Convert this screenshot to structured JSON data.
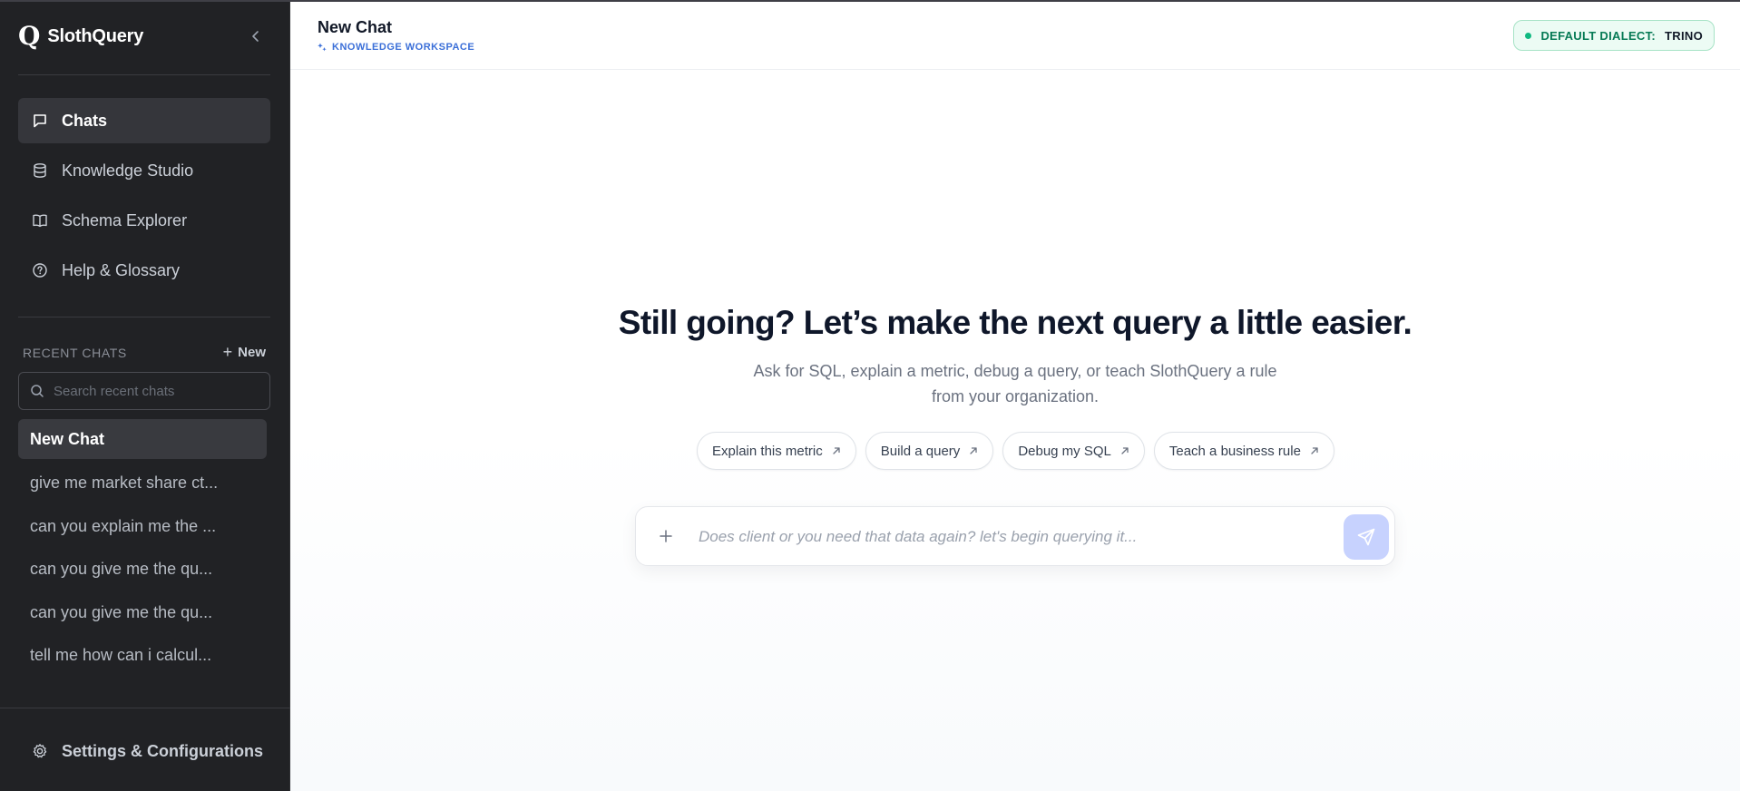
{
  "app": {
    "logo_glyph": "Q",
    "name": "SlothQuery"
  },
  "sidebar": {
    "nav": [
      {
        "label": "Chats",
        "icon": "chat-bubble-icon",
        "active": true
      },
      {
        "label": "Knowledge Studio",
        "icon": "database-icon",
        "active": false
      },
      {
        "label": "Schema Explorer",
        "icon": "book-icon",
        "active": false
      },
      {
        "label": "Help & Glossary",
        "icon": "help-circle-icon",
        "active": false
      }
    ],
    "recent": {
      "title": "RECENT CHATS",
      "new_label": "New",
      "search_placeholder": "Search recent chats",
      "items": [
        {
          "label": "New Chat",
          "active": true
        },
        {
          "label": "give me market share ct...",
          "active": false
        },
        {
          "label": "can you explain me the ...",
          "active": false
        },
        {
          "label": "can you give me the qu...",
          "active": false
        },
        {
          "label": "can you give me the qu...",
          "active": false
        },
        {
          "label": "tell me how can i calcul...",
          "active": false
        }
      ]
    },
    "settings_label": "Settings & Configurations"
  },
  "header": {
    "title": "New Chat",
    "workspace_label": "KNOWLEDGE WORKSPACE",
    "dialect_label": "DEFAULT DIALECT:",
    "dialect_value": "TRINO"
  },
  "hero": {
    "title": "Still going? Let’s make the next query a little easier.",
    "subtitle": "Ask for SQL, explain a metric, debug a query, or teach SlothQuery a rule from your organization."
  },
  "suggestions": [
    {
      "label": "Explain this metric"
    },
    {
      "label": "Build a query"
    },
    {
      "label": "Debug my SQL"
    },
    {
      "label": "Teach a business rule"
    }
  ],
  "composer": {
    "placeholder": "Does client or you need that data again? let's begin querying it..."
  },
  "colors": {
    "sidebar_bg": "#212225",
    "accent_blue": "#3b6fd8",
    "dialect_green": "#10b981",
    "send_button": "#c7d2fe"
  }
}
